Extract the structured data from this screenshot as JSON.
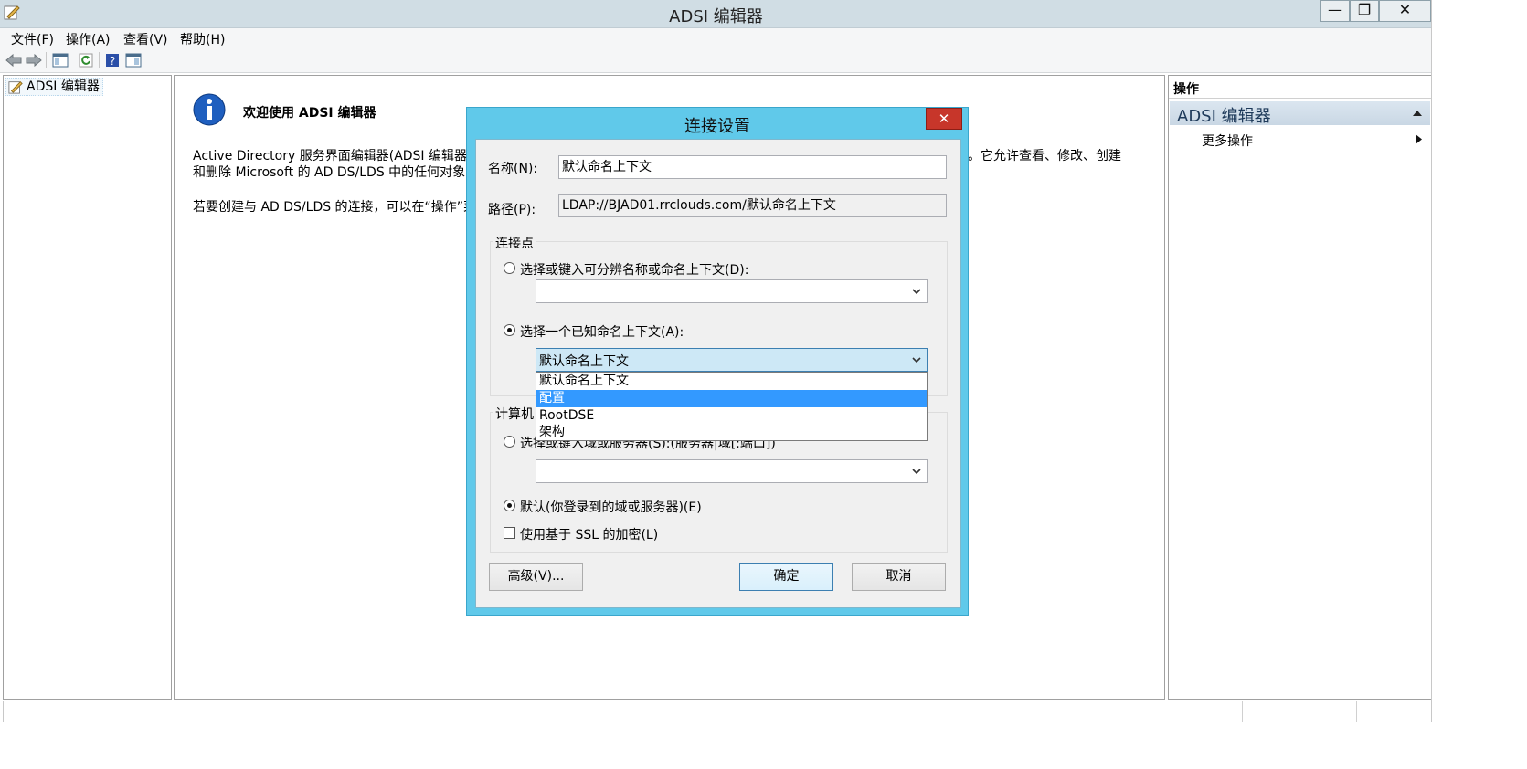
{
  "window": {
    "title": "ADSI 编辑器",
    "controls": {
      "minimize": "—",
      "maximize": "❐",
      "close": "✕"
    }
  },
  "menubar": {
    "items": [
      "文件(F)",
      "操作(A)",
      "查看(V)",
      "帮助(H)"
    ]
  },
  "toolbar": {
    "icons": [
      "back-arrow-icon",
      "forward-arrow-icon",
      "show-hide-console-tree-icon",
      "refresh-icon",
      "help-icon",
      "show-hide-action-pane-icon"
    ]
  },
  "tree": {
    "root_label": "ADSI 编辑器"
  },
  "center": {
    "welcome_title": "欢迎使用 ADSI 编辑器",
    "para1_line1_left": "Active Directory 服务界面编辑器(ADSI 编辑器)",
    "para1_line1_right": "。它允许查看、修改、创建",
    "para1_line2_left": "和删除 Microsoft 的 AD DS/LDS 中的任何对象",
    "para2_left": "若要创建与 AD DS/LDS 的连接，可以在“操作”菜"
  },
  "actions": {
    "header": "操作",
    "section_title": "ADSI 编辑器",
    "more_actions": "更多操作"
  },
  "dialog": {
    "title": "连接设置",
    "close_glyph": "✕",
    "name_label": "名称(N):",
    "name_value": "默认命名上下文",
    "path_label": "路径(P):",
    "path_value": "LDAP://BJAD01.rrclouds.com/默认命名上下文",
    "connection_point": {
      "title": "连接点",
      "option_dn_label": "选择或键入可分辨名称或命名上下文(D):",
      "option_dn_value": "",
      "option_known_label": "选择一个已知命名上下文(A):",
      "option_known_value": "默认命名上下文",
      "selected_option": "known"
    },
    "dropdown": {
      "options": [
        "默认命名上下文",
        "配置",
        "RootDSE",
        "架构"
      ],
      "highlighted": "配置"
    },
    "computer": {
      "title": "计算机",
      "option_server_label": "选择或键入域或服务器(S):(服务器|域[:端口])",
      "option_server_value": "",
      "option_default_label": "默认(你登录到的域或服务器)(E)",
      "selected_option": "default",
      "ssl_label": "使用基于 SSL 的加密(L)",
      "ssl_checked": false
    },
    "buttons": {
      "advanced": "高级(V)...",
      "ok": "确定",
      "cancel": "取消"
    }
  }
}
